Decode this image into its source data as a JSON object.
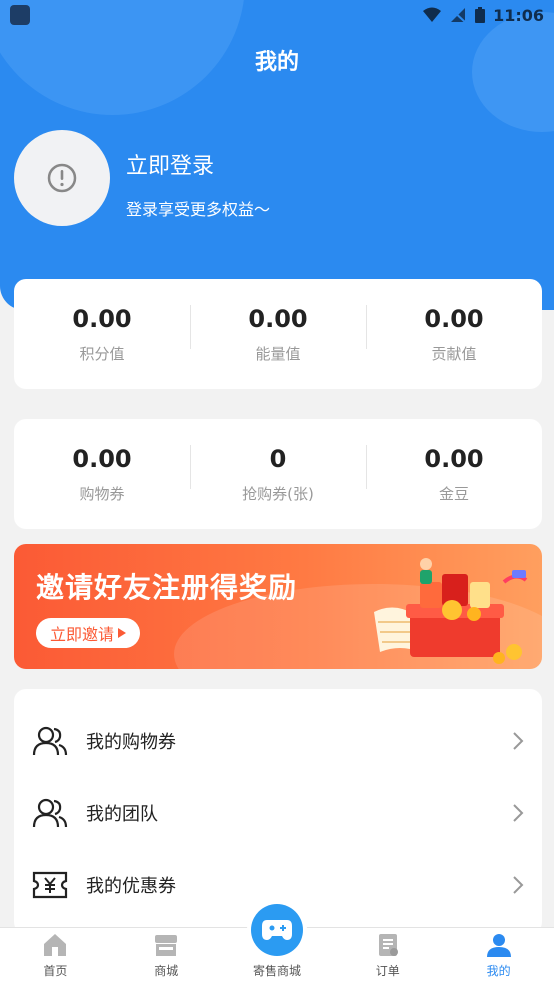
{
  "status_bar": {
    "time": "11:06"
  },
  "header": {
    "title": "我的"
  },
  "profile": {
    "login_title": "立即登录",
    "login_subtitle": "登录享受更多权益～"
  },
  "stats_primary": [
    {
      "value": "0.00",
      "label": "积分值"
    },
    {
      "value": "0.00",
      "label": "能量值"
    },
    {
      "value": "0.00",
      "label": "贡献值"
    }
  ],
  "stats_secondary": [
    {
      "value": "0.00",
      "label": "购物券"
    },
    {
      "value": "0",
      "label": "抢购券(张)"
    },
    {
      "value": "0.00",
      "label": "金豆"
    }
  ],
  "banner": {
    "title": "邀请好友注册得奖励",
    "button_label": "立即邀请"
  },
  "menu": [
    {
      "label": "我的购物券",
      "icon": "users-icon"
    },
    {
      "label": "我的团队",
      "icon": "users-icon"
    },
    {
      "label": "我的优惠券",
      "icon": "yen-ticket-icon"
    }
  ],
  "tabbar": {
    "items": [
      {
        "label": "首页",
        "icon": "home-icon"
      },
      {
        "label": "商城",
        "icon": "store-icon"
      },
      {
        "label": "寄售商城",
        "icon": "gamepad-icon"
      },
      {
        "label": "订单",
        "icon": "order-icon"
      },
      {
        "label": "我的",
        "icon": "user-icon"
      }
    ],
    "active_index": 4
  },
  "colors": {
    "primary": "#2b8af0",
    "banner": "#fb5a35",
    "background": "#f2f2f2"
  }
}
